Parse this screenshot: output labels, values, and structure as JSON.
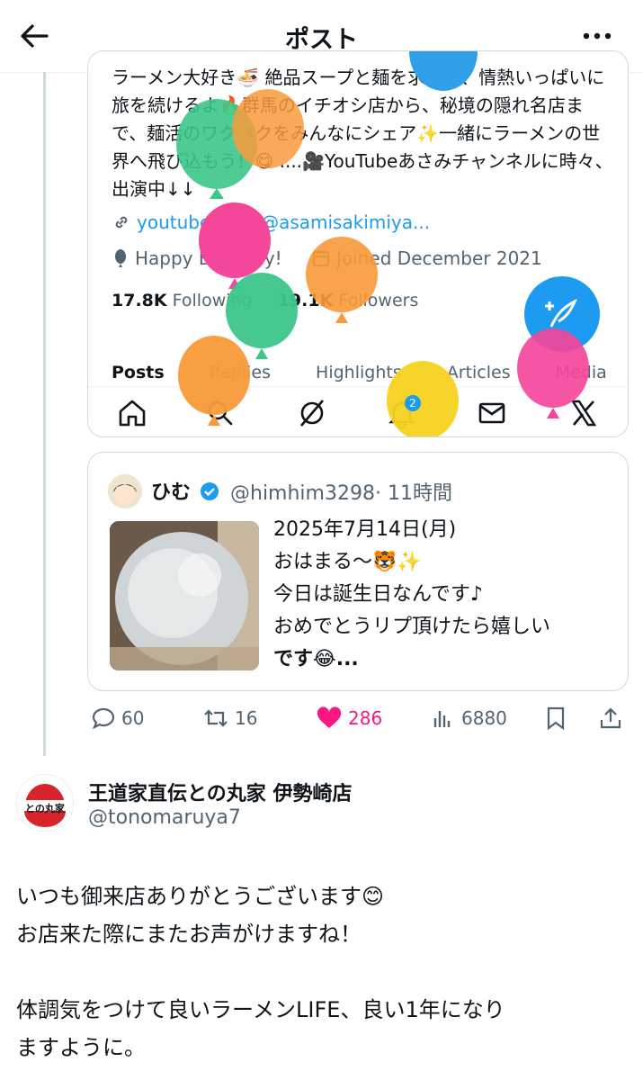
{
  "header": {
    "title": "ポスト"
  },
  "profile": {
    "bio": "ラーメン大好き🍜 絶品スープと麺を求めて、情熱いっぱいに旅を続けるよ🔥群馬のイチオシ店から、秘境の隠れ名店まで、麺活のワクワクをみんなにシェア✨一緒にラーメンの世界へ飛び込もう！😋 ....🎥YouTubeあさみチャンネルに時々、出演中↓↓",
    "link": "youtube.com/@asamisakimiya...",
    "birthday": "Happy Birthday!",
    "joined": "Joined December 2021",
    "following_count": "17.8K",
    "following_label": "Following",
    "followers_count": "19.1K",
    "followers_label": "Followers",
    "tabs": [
      "Posts",
      "Replies",
      "Highlights",
      "Articles",
      "Media"
    ],
    "notif_badge": "2"
  },
  "quote": {
    "name": "ひむ",
    "handle": "@himhim3298",
    "time": "· 11時間",
    "text_lines": [
      "2025年7月14日(月)",
      "おはまる〜🐯✨",
      "今日は誕生日なんです♪",
      "おめでとうリプ頂けたら嬉しい",
      "です😂..."
    ]
  },
  "actions": {
    "replies": "60",
    "reposts": "16",
    "likes": "286",
    "views": "6880"
  },
  "reply": {
    "name": "王道家直伝との丸家 伊勢崎店",
    "handle": "@tonomaruya7",
    "avatar_text": "との丸家",
    "lines": [
      "いつも御来店ありがとうございます😊",
      "お店来た際にまたお声がけますね！",
      "",
      "体調気をつけて良いラーメンLIFE、良い1年になり",
      "ますように。"
    ]
  },
  "colors": {
    "accent": "#1d9bf0",
    "like": "#f91880",
    "balloon_pink": "#f4479a",
    "balloon_orange": "#f89a3a",
    "balloon_green": "#3cc68a",
    "balloon_yellow": "#f7d21e",
    "balloon_blue": "#2fa0e8"
  },
  "icons": [
    "back-arrow-icon",
    "more-icon",
    "link-icon",
    "balloon-icon",
    "calendar-icon",
    "home-icon",
    "search-icon",
    "grok-icon",
    "bell-icon",
    "mail-icon",
    "x-logo-icon",
    "compose-icon",
    "verified-icon",
    "reply-icon",
    "repost-icon",
    "heart-icon",
    "views-icon",
    "bookmark-icon",
    "share-icon"
  ]
}
